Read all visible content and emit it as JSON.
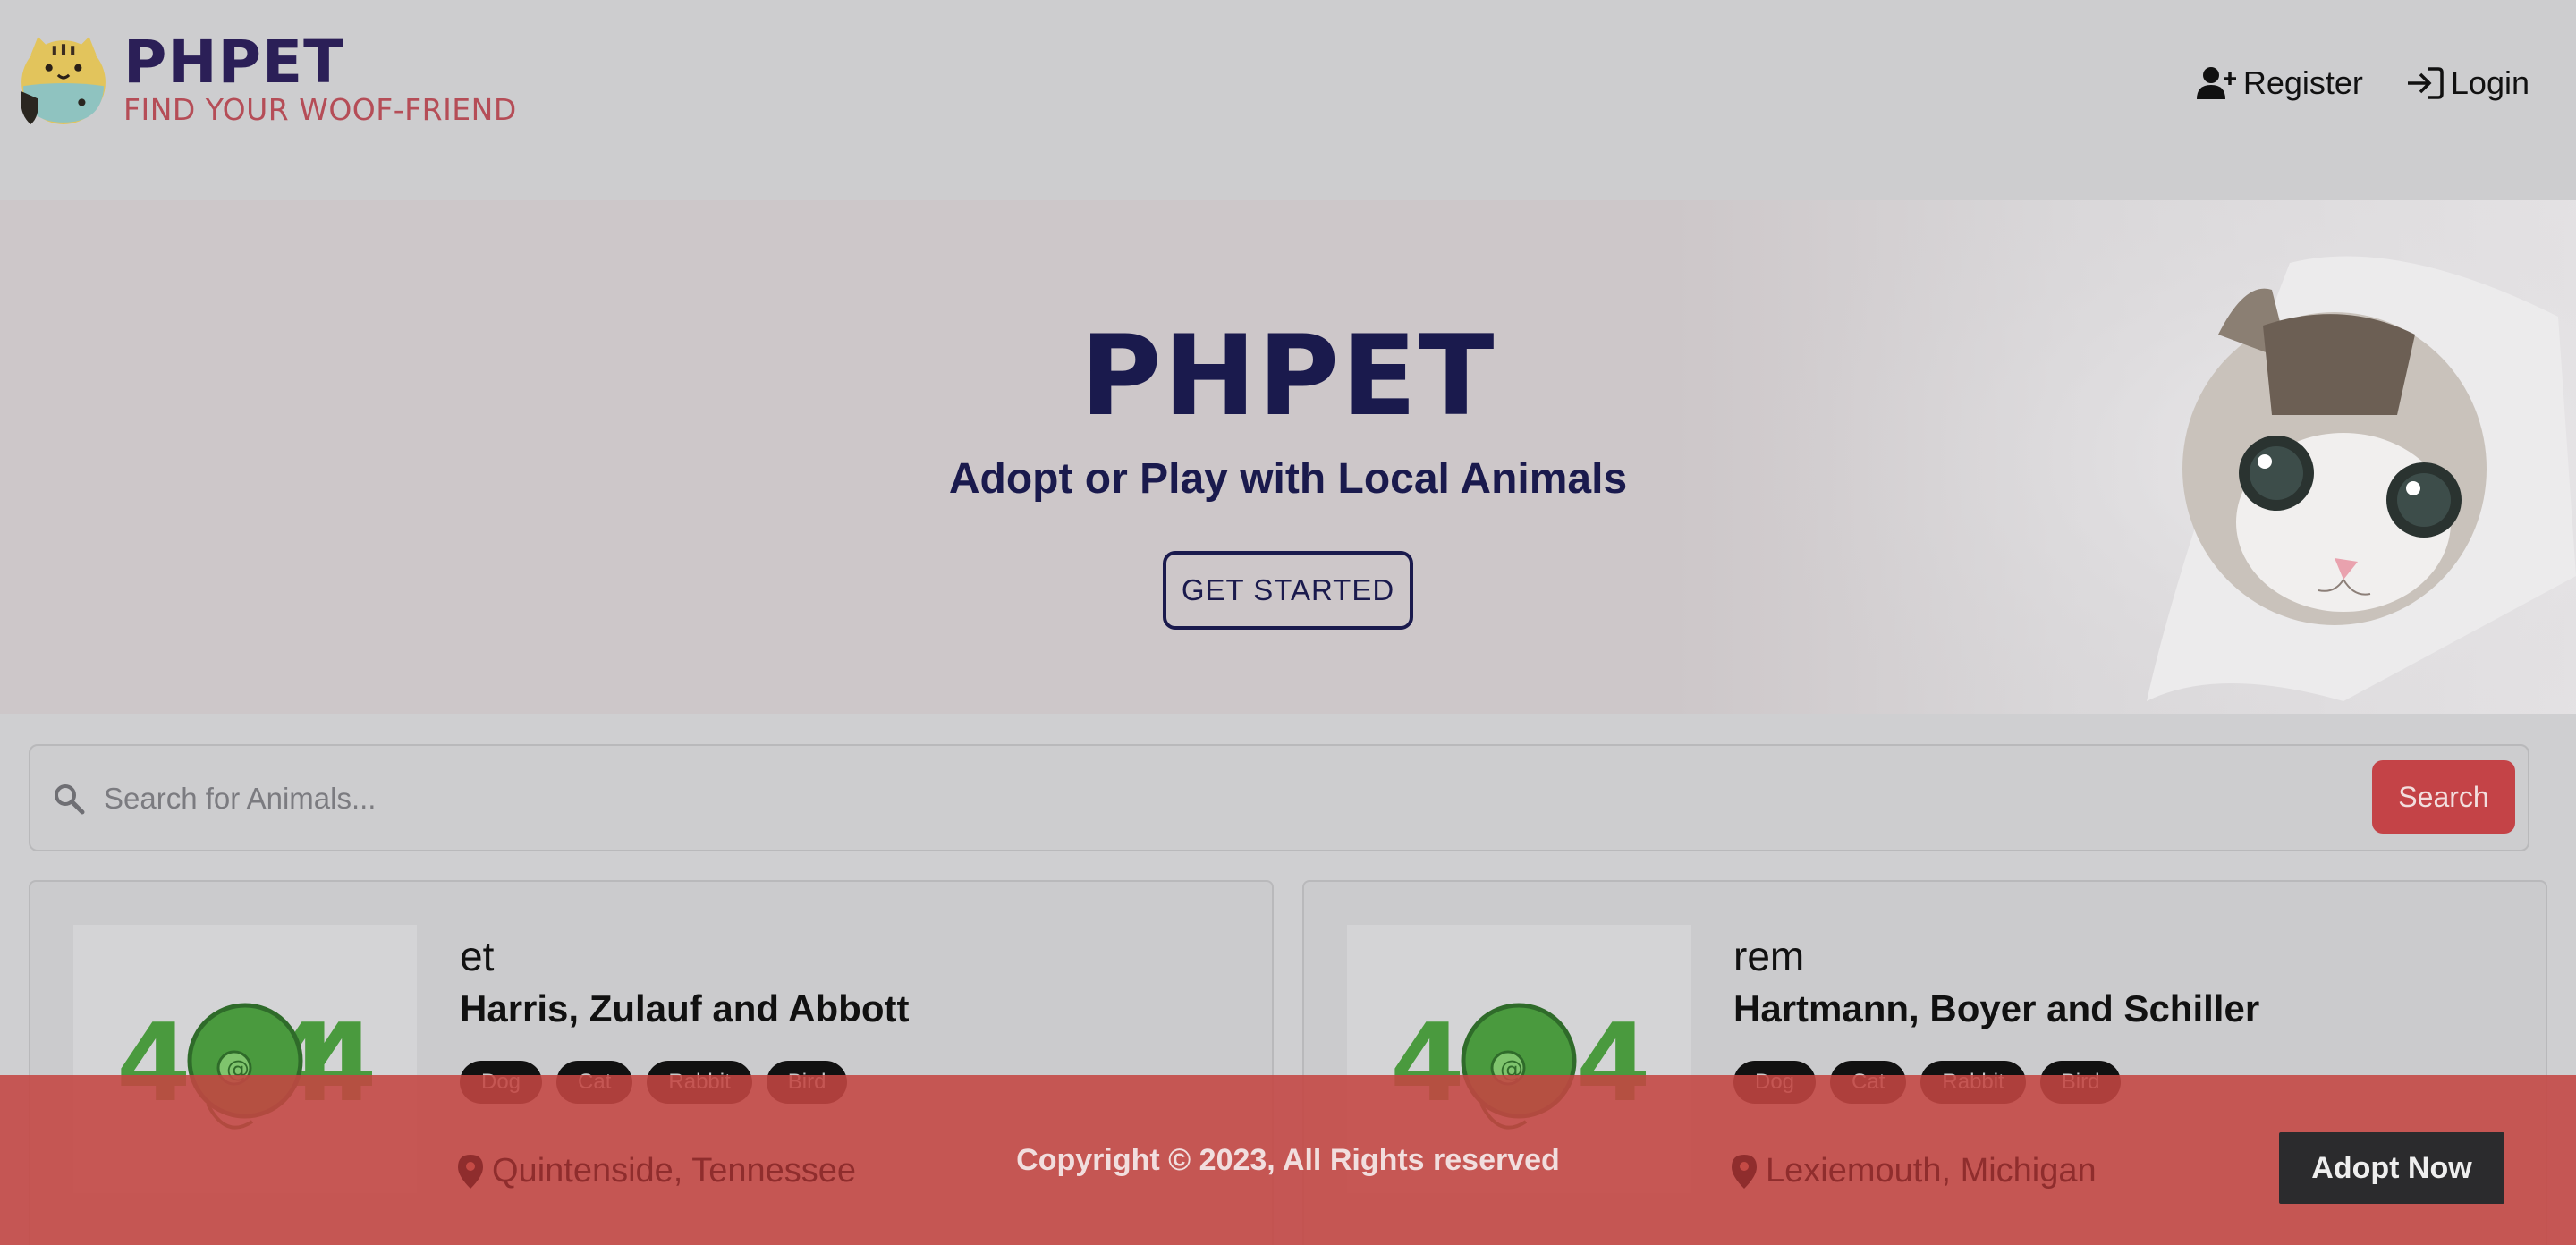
{
  "brand": {
    "title": "PHPET",
    "tagline": "FIND YOUR WOOF-FRIEND"
  },
  "nav": {
    "register": "Register",
    "login": "Login"
  },
  "hero": {
    "title": "PHPET",
    "subtitle": "Adopt or Play with Local Animals",
    "cta": "GET STARTED"
  },
  "search": {
    "placeholder": "Search for Animals...",
    "button": "Search"
  },
  "cards": [
    {
      "image_text": "404",
      "name": "et",
      "org": "Harris, Zulauf and Abbott",
      "tags": [
        "Dog",
        "Cat",
        "Rabbit",
        "Bird"
      ],
      "location": "Quintenside, Tennessee"
    },
    {
      "image_text": "404",
      "name": "rem",
      "org": "Hartmann, Boyer and Schiller",
      "tags": [
        "Dog",
        "Cat",
        "Rabbit",
        "Bird"
      ],
      "location": "Lexiemouth, Michigan"
    }
  ],
  "footer": {
    "copyright": "Copyright © 2023, All Rights reserved",
    "adopt_button": "Adopt Now"
  },
  "colors": {
    "brand_navy": "#1a1a4d",
    "accent_red": "#c44347",
    "tag_bg": "#111111"
  }
}
